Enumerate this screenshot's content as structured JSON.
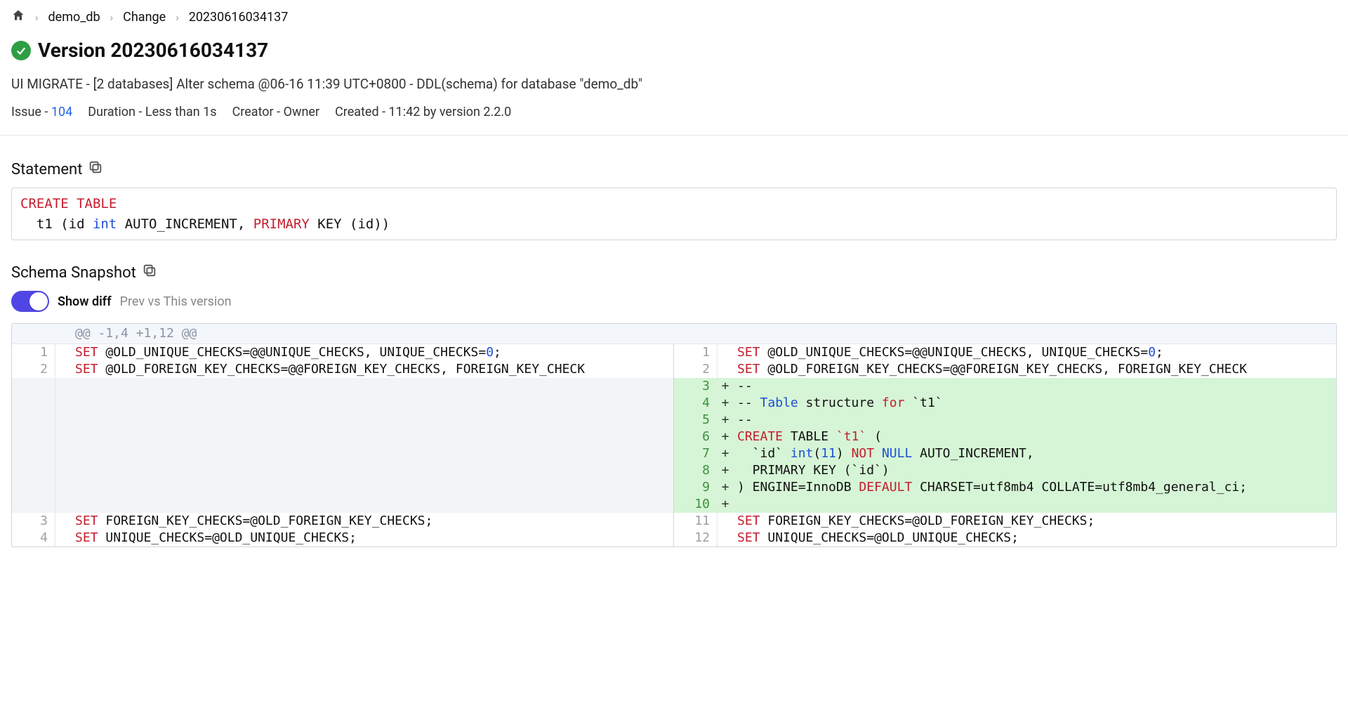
{
  "breadcrumb": {
    "items": [
      "demo_db",
      "Change",
      "20230616034137"
    ]
  },
  "title": {
    "prefix": "Version",
    "version": "20230616034137"
  },
  "subtitle": "UI MIGRATE - [2 databases] Alter schema @06-16 11:39 UTC+0800 - DDL(schema) for database \"demo_db\"",
  "meta": {
    "issue_label": "Issue -",
    "issue_number": "104",
    "duration_label": "Duration -",
    "duration_value": "Less than 1s",
    "creator_label": "Creator -",
    "creator_value": "Owner",
    "created_label": "Created -",
    "created_value": "11:42 by version 2.2.0"
  },
  "sections": {
    "statement_header": "Statement",
    "snapshot_header": "Schema Snapshot"
  },
  "statement": {
    "tokens": [
      {
        "t": "CREATE TABLE",
        "c": "kw-red"
      },
      {
        "t": "\n  t1 (id ",
        "c": ""
      },
      {
        "t": "int",
        "c": "kw-blue"
      },
      {
        "t": " AUTO_INCREMENT, ",
        "c": ""
      },
      {
        "t": "PRIMARY",
        "c": "kw-red"
      },
      {
        "t": " KEY (id))",
        "c": ""
      }
    ]
  },
  "toggle": {
    "on": true,
    "label": "Show diff",
    "sublabel": "Prev vs This version"
  },
  "diff": {
    "hunk": "@@ -1,4 +1,12 @@",
    "left": [
      {
        "n": "1",
        "type": "ctx",
        "tokens": [
          {
            "t": "SET",
            "c": "tok-kw"
          },
          {
            "t": " @OLD_UNIQUE_CHECKS=@@UNIQUE_CHECKS, UNIQUE_CHECKS=",
            "c": ""
          },
          {
            "t": "0",
            "c": "tok-type"
          },
          {
            "t": ";",
            "c": ""
          }
        ]
      },
      {
        "n": "2",
        "type": "ctx",
        "tokens": [
          {
            "t": "SET",
            "c": "tok-kw"
          },
          {
            "t": " @OLD_FOREIGN_KEY_CHECKS=@@FOREIGN_KEY_CHECKS, FOREIGN_KEY_CHECK",
            "c": ""
          }
        ]
      },
      {
        "n": "",
        "type": "empty"
      },
      {
        "n": "",
        "type": "empty"
      },
      {
        "n": "",
        "type": "empty"
      },
      {
        "n": "",
        "type": "empty"
      },
      {
        "n": "",
        "type": "empty"
      },
      {
        "n": "",
        "type": "empty"
      },
      {
        "n": "",
        "type": "empty"
      },
      {
        "n": "",
        "type": "empty"
      },
      {
        "n": "3",
        "type": "ctx",
        "tokens": [
          {
            "t": "SET",
            "c": "tok-kw"
          },
          {
            "t": " FOREIGN_KEY_CHECKS=@OLD_FOREIGN_KEY_CHECKS;",
            "c": ""
          }
        ]
      },
      {
        "n": "4",
        "type": "ctx",
        "tokens": [
          {
            "t": "SET",
            "c": "tok-kw"
          },
          {
            "t": " UNIQUE_CHECKS=@OLD_UNIQUE_CHECKS;",
            "c": ""
          }
        ]
      }
    ],
    "right": [
      {
        "n": "1",
        "type": "ctx",
        "tokens": [
          {
            "t": "SET",
            "c": "tok-kw"
          },
          {
            "t": " @OLD_UNIQUE_CHECKS=@@UNIQUE_CHECKS, UNIQUE_CHECKS=",
            "c": ""
          },
          {
            "t": "0",
            "c": "tok-type"
          },
          {
            "t": ";",
            "c": ""
          }
        ]
      },
      {
        "n": "2",
        "type": "ctx",
        "tokens": [
          {
            "t": "SET",
            "c": "tok-kw"
          },
          {
            "t": " @OLD_FOREIGN_KEY_CHECKS=@@FOREIGN_KEY_CHECKS, FOREIGN_KEY_CHECK",
            "c": ""
          }
        ]
      },
      {
        "n": "3",
        "type": "add",
        "tokens": [
          {
            "t": "--",
            "c": ""
          }
        ]
      },
      {
        "n": "4",
        "type": "add",
        "tokens": [
          {
            "t": "-- ",
            "c": ""
          },
          {
            "t": "Table",
            "c": "tok-type"
          },
          {
            "t": " structure ",
            "c": ""
          },
          {
            "t": "for",
            "c": "tok-kw"
          },
          {
            "t": " `t1`",
            "c": ""
          }
        ]
      },
      {
        "n": "5",
        "type": "add",
        "tokens": [
          {
            "t": "--",
            "c": ""
          }
        ]
      },
      {
        "n": "6",
        "type": "add",
        "tokens": [
          {
            "t": "CREATE",
            "c": "tok-kw"
          },
          {
            "t": " TABLE ",
            "c": ""
          },
          {
            "t": "`t1`",
            "c": "tok-id"
          },
          {
            "t": " (",
            "c": ""
          }
        ]
      },
      {
        "n": "7",
        "type": "add",
        "tokens": [
          {
            "t": "  `id` ",
            "c": ""
          },
          {
            "t": "int",
            "c": "tok-type"
          },
          {
            "t": "(",
            "c": ""
          },
          {
            "t": "11",
            "c": "tok-type"
          },
          {
            "t": ") ",
            "c": ""
          },
          {
            "t": "NOT",
            "c": "tok-kw"
          },
          {
            "t": " ",
            "c": ""
          },
          {
            "t": "NULL",
            "c": "tok-type"
          },
          {
            "t": " AUTO_INCREMENT,",
            "c": ""
          }
        ]
      },
      {
        "n": "8",
        "type": "add",
        "tokens": [
          {
            "t": "  PRIMARY KEY (`id`)",
            "c": ""
          }
        ]
      },
      {
        "n": "9",
        "type": "add",
        "tokens": [
          {
            "t": ") ENGINE=InnoDB ",
            "c": ""
          },
          {
            "t": "DEFAULT",
            "c": "tok-kw"
          },
          {
            "t": " CHARSET=utf8mb4 COLLATE=utf8mb4_general_ci;",
            "c": ""
          }
        ]
      },
      {
        "n": "10",
        "type": "add",
        "tokens": []
      },
      {
        "n": "11",
        "type": "ctx",
        "tokens": [
          {
            "t": "SET",
            "c": "tok-kw"
          },
          {
            "t": " FOREIGN_KEY_CHECKS=@OLD_FOREIGN_KEY_CHECKS;",
            "c": ""
          }
        ]
      },
      {
        "n": "12",
        "type": "ctx",
        "tokens": [
          {
            "t": "SET",
            "c": "tok-kw"
          },
          {
            "t": " UNIQUE_CHECKS=@OLD_UNIQUE_CHECKS;",
            "c": ""
          }
        ]
      }
    ]
  }
}
